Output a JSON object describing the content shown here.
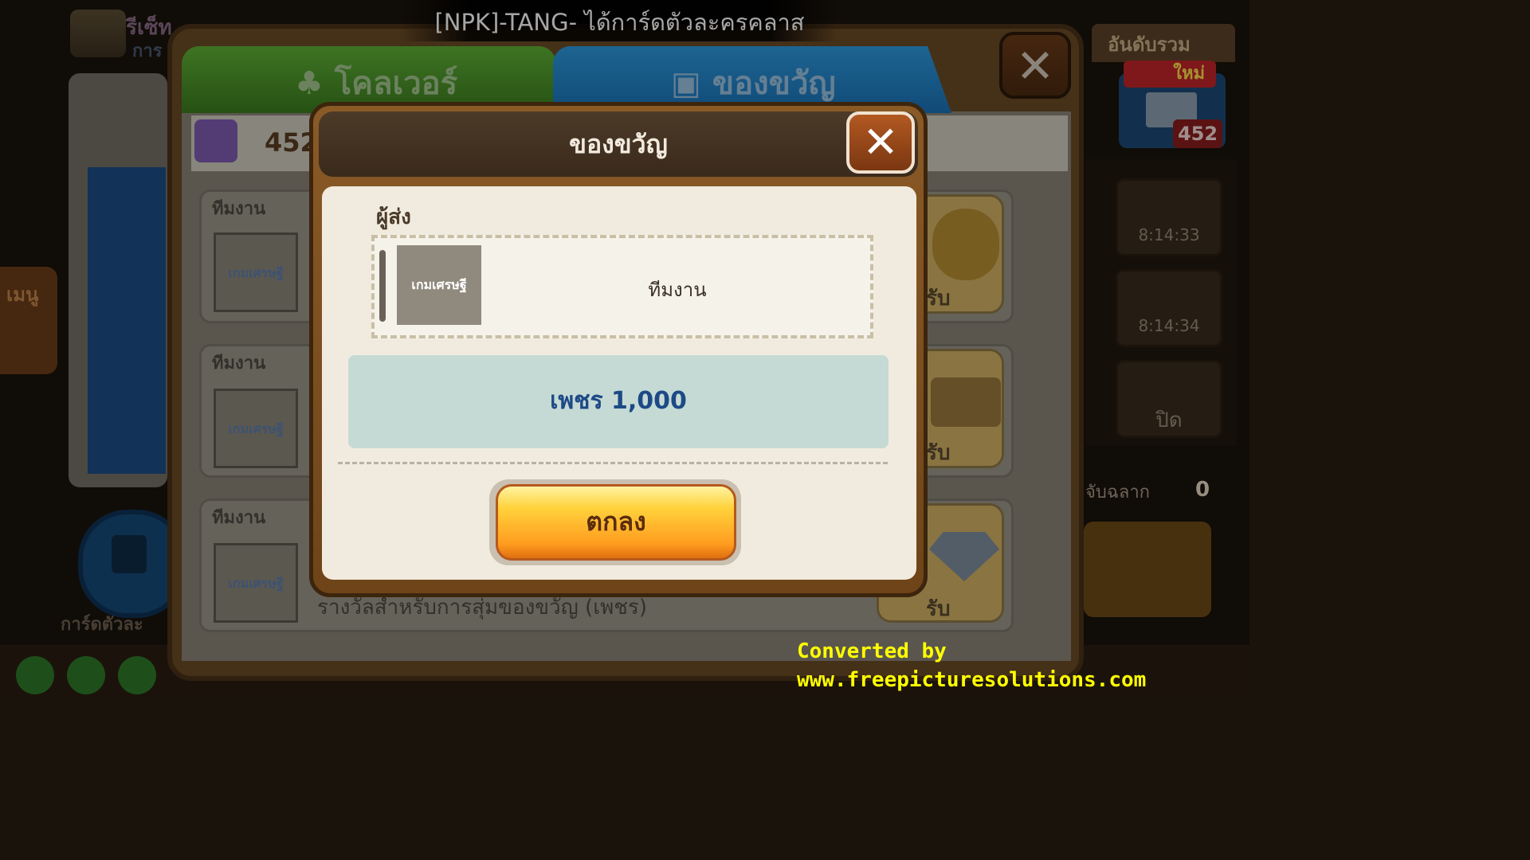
{
  "hud": {
    "reset_text": "รีเซ็ท",
    "reset_sub": "การ",
    "notification": "[NPK]-TANG- ได้การ์ดตัวละครคลาส",
    "rank_tab": "อันดับรวม",
    "new_badge": "ใหม่",
    "mail_count": "452",
    "timers": [
      "8:14:33",
      "8:14:34",
      "ปิด"
    ],
    "lottery_label": "จับฉลาก",
    "lottery_count": "0",
    "side_menu": "เมนู",
    "profile_label": "การ์ดตัวละ"
  },
  "back_panel": {
    "tabs": [
      {
        "label": "โคลเวอร์",
        "icon": "clover-icon"
      },
      {
        "label": "ของขวัญ",
        "icon": "gift-icon"
      }
    ],
    "close_symbol": "✕",
    "gift_count": "452",
    "rows": [
      {
        "sender": "ทีมงาน",
        "logo": "เกมเศรษฐี",
        "action": "รับ",
        "reward_icon": "coins-icon"
      },
      {
        "sender": "ทีมงาน",
        "logo": "เกมเศรษฐี",
        "action": "รับ",
        "reward_icon": "treasure-chest-icon"
      },
      {
        "sender": "ทีมงาน",
        "logo": "เกมเศรษฐี",
        "action": "รับ",
        "reward_icon": "diamond-icon"
      }
    ],
    "row_description": "รางวัลสำหรับการสุ่มของขวัญ (เพชร)"
  },
  "modal": {
    "title": "ของขวัญ",
    "close_symbol": "✕",
    "sender_label": "ผู้ส่ง",
    "sender_logo": "เกมเศรษฐี",
    "sender_name": "ทีมงาน",
    "reward_text": "เพชร 1,000",
    "ok_label": "ตกลง"
  },
  "watermark": {
    "line1": "Converted by",
    "line2": "www.freepicturesolutions.com"
  },
  "colors": {
    "clover_tab": "#4a9a2a",
    "gift_tab": "#2389cf",
    "modal_frame": "#7a4d1e",
    "ok_button": "#ffb02a",
    "reward_box": "#c5dad4",
    "watermark": "#ffff00"
  }
}
